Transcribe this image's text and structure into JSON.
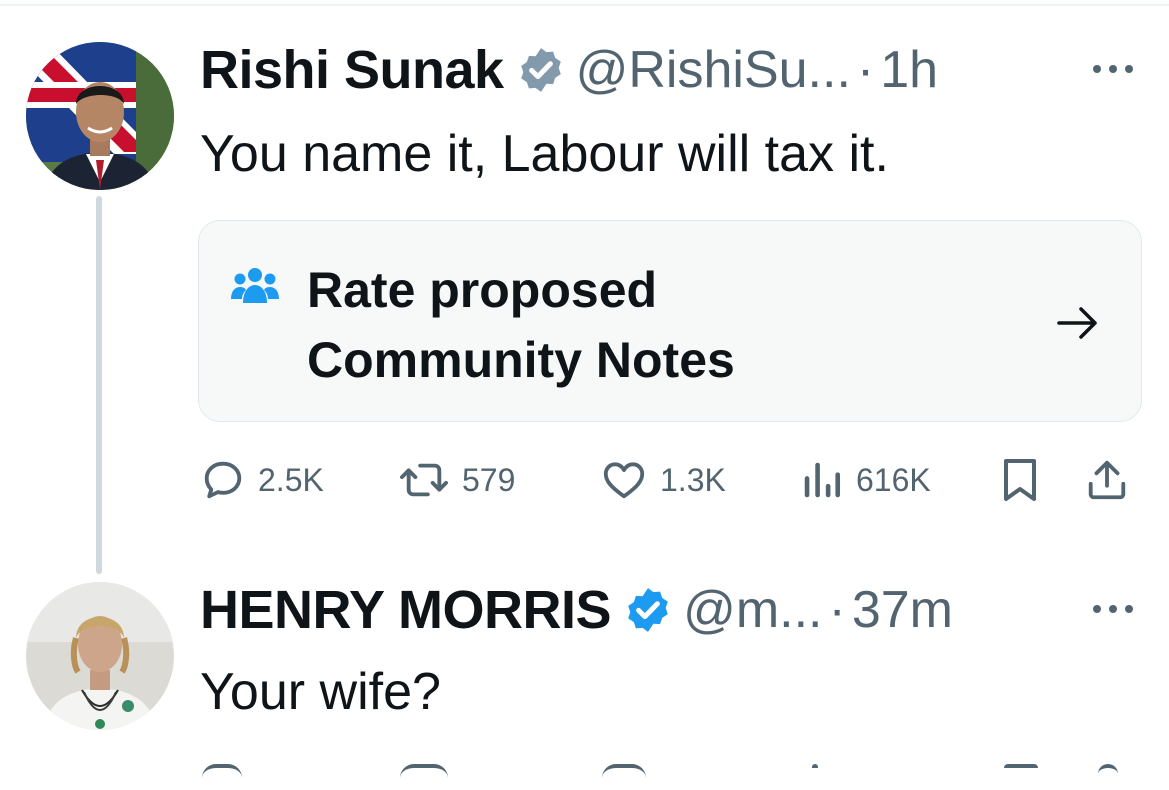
{
  "tweet": {
    "author_name": "Rishi Sunak",
    "handle": "@RishiSu...",
    "separator": "·",
    "time": "1h",
    "text": "You name it, Labour will tax it.",
    "community_notes": {
      "line1": "Rate proposed",
      "line2": "Community Notes"
    },
    "actions": {
      "replies": "2.5K",
      "reposts": "579",
      "likes": "1.3K",
      "views": "616K"
    },
    "icons": {
      "verified": "verified-badge-icon",
      "more": "more-options-icon",
      "notes": "community-people-icon",
      "arrow": "arrow-right-icon",
      "reply": "reply-icon",
      "repost": "repost-icon",
      "like": "heart-icon",
      "views": "views-bar-icon",
      "bookmark": "bookmark-icon",
      "share": "share-icon"
    }
  },
  "reply": {
    "author_name": "HENRY MORRIS",
    "handle": "@m...",
    "separator": "·",
    "time": "37m",
    "text": "Your wife?"
  },
  "colors": {
    "text": "#0f1419",
    "secondary": "#536471",
    "verified_gray": "#829aab",
    "verified_blue": "#1d9bf0",
    "card_bg": "#f7f9f9"
  }
}
